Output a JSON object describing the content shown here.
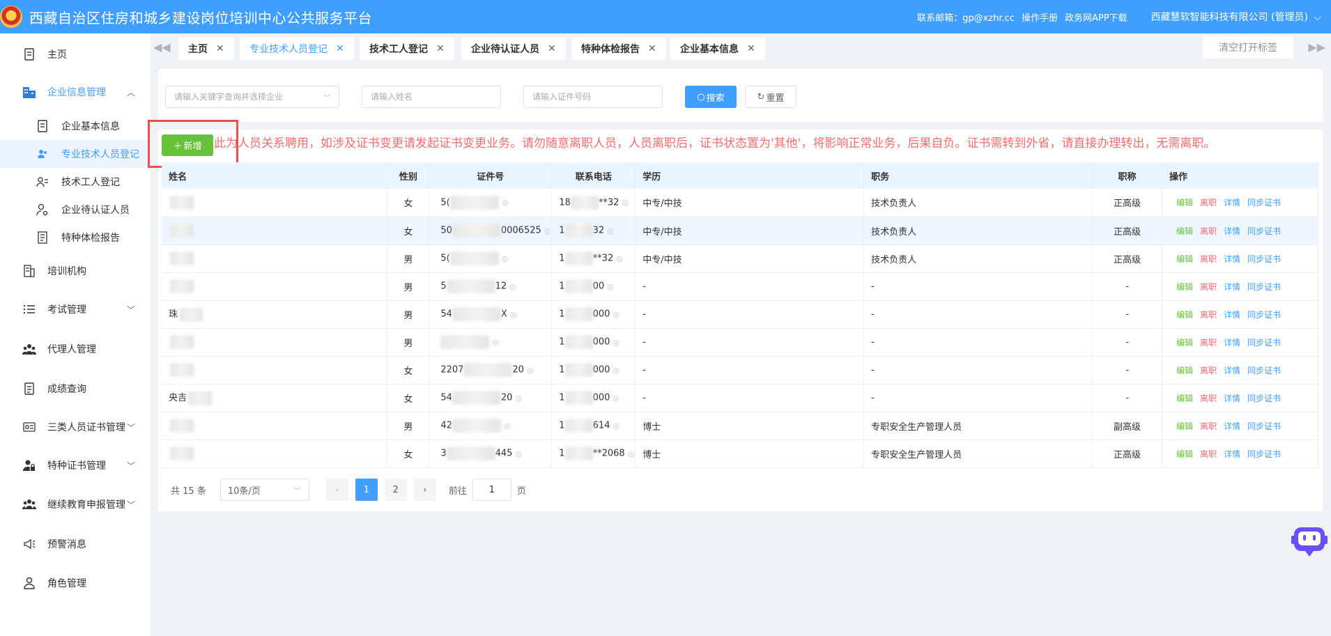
{
  "header": {
    "title": "西藏自治区住房和城乡建设岗位培训中心公共服务平台",
    "email": "联系邮箱：gp@xzhr.cc",
    "manual": "操作手册",
    "app_download": "政务网APP下载",
    "company": "西藏慧软智能科技有限公司 (管理员)"
  },
  "sidebar": {
    "items": [
      {
        "label": "主页"
      },
      {
        "label": "企业信息管理"
      },
      {
        "label": "企业基本信息"
      },
      {
        "label": "专业技术人员登记"
      },
      {
        "label": "技术工人登记"
      },
      {
        "label": "企业待认证人员"
      },
      {
        "label": "特种体检报告"
      },
      {
        "label": "培训机构"
      },
      {
        "label": "考试管理"
      },
      {
        "label": "代理人管理"
      },
      {
        "label": "成绩查询"
      },
      {
        "label": "三类人员证书管理"
      },
      {
        "label": "特种证书管理"
      },
      {
        "label": "继续教育申报管理"
      },
      {
        "label": "预警消息"
      },
      {
        "label": "角色管理"
      }
    ]
  },
  "tabs": [
    {
      "label": "主页"
    },
    {
      "label": "专业技术人员登记"
    },
    {
      "label": "技术工人登记"
    },
    {
      "label": "企业待认证人员"
    },
    {
      "label": "特种体检报告"
    },
    {
      "label": "企业基本信息"
    }
  ],
  "tabs_clear": "清空打开标签",
  "search": {
    "company_placeholder": "请输入关键字查询并选择企业",
    "name_placeholder": "请输入姓名",
    "id_placeholder": "请输入证件号码",
    "search_label": "搜索",
    "reset_label": "重置"
  },
  "add_label": "新增",
  "notice": "此为人员关系聘用，如涉及证书变更请发起证书变更业务。请勿随意离职人员，人员离职后，证书状态置为'其他'，将影响正常业务，后果自负。证书需转到外省，请直接办理转出，无需离职。",
  "table": {
    "columns": [
      "姓名",
      "性别",
      "证件号",
      "联系电话",
      "学历",
      "职务",
      "职称",
      "操作"
    ],
    "actions": {
      "edit": "编辑",
      "leave": "离职",
      "detail": "详情",
      "sync": "同步证书"
    },
    "rows": [
      {
        "name_visible": "",
        "gender": "女",
        "id_visible": "5(",
        "phone_visible": "18",
        "phone_tail": "**32",
        "education": "中专/中技",
        "position": "技术负责人",
        "title": "正高级"
      },
      {
        "name_visible": "",
        "gender": "女",
        "id_visible": "50",
        "id_tail": "0006525",
        "phone_visible": "1",
        "phone_tail": "32",
        "education": "中专/中技",
        "position": "技术负责人",
        "title": "正高级"
      },
      {
        "name_visible": "",
        "gender": "男",
        "id_visible": "5(",
        "phone_visible": "1",
        "phone_tail": "**32",
        "education": "中专/中技",
        "position": "技术负责人",
        "title": "正高级"
      },
      {
        "name_visible": "",
        "gender": "男",
        "id_visible": "5",
        "id_tail": "12",
        "phone_visible": "1",
        "phone_tail": "00",
        "education": "-",
        "position": "-",
        "title": "-"
      },
      {
        "name_visible": "珠",
        "gender": "男",
        "id_visible": "54",
        "id_tail": "X",
        "phone_visible": "1",
        "phone_tail": "000",
        "education": "-",
        "position": "-",
        "title": "-"
      },
      {
        "name_visible": "",
        "gender": "男",
        "id_visible": "",
        "phone_visible": "1",
        "phone_tail": "000",
        "education": "-",
        "position": "-",
        "title": "-"
      },
      {
        "name_visible": "",
        "gender": "女",
        "id_visible": "2207",
        "id_tail": "20",
        "phone_visible": "1",
        "phone_tail": "000",
        "education": "-",
        "position": "-",
        "title": "-"
      },
      {
        "name_visible": "央吉",
        "gender": "女",
        "id_visible": "54",
        "id_tail": "20",
        "phone_visible": "1",
        "phone_tail": "000",
        "education": "-",
        "position": "-",
        "title": "-"
      },
      {
        "name_visible": "",
        "gender": "男",
        "id_visible": "42",
        "phone_visible": "1",
        "phone_tail": "614",
        "education": "博士",
        "position": "专职安全生产管理人员",
        "title": "副高级"
      },
      {
        "name_visible": "",
        "gender": "女",
        "id_visible": "3",
        "id_tail": "445",
        "phone_visible": "1",
        "phone_tail": "**2068",
        "education": "博士",
        "position": "专职安全生产管理人员",
        "title": "正高级"
      }
    ]
  },
  "pagination": {
    "total": "共 15 条",
    "page_size": "10条/页",
    "pages": [
      "1",
      "2"
    ],
    "goto_label": "前往",
    "goto_value": "1",
    "page_unit": "页"
  }
}
